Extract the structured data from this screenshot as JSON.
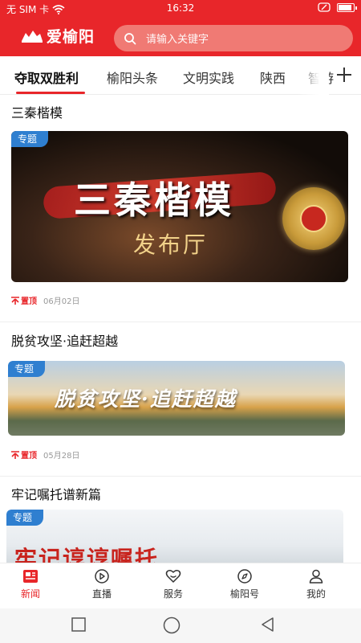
{
  "status_bar": {
    "carrier": "无 SIM 卡",
    "time": "16:32",
    "battery_level": 0.95
  },
  "header": {
    "logo_text": "爱榆阳",
    "search_placeholder": "请输入关键字"
  },
  "tabs": [
    "夺取双胜利",
    "榆阳头条",
    "文明实践",
    "陕西",
    "智游"
  ],
  "active_tab": "夺取双胜利",
  "feed": [
    {
      "title": "三秦楷模",
      "tag": "专题",
      "banner_title": "三秦楷模",
      "banner_subtitle": "发布厅",
      "pin": "置顶",
      "date": "06月02日"
    },
    {
      "title": "脱贫攻坚·追赶超越",
      "tag": "专题",
      "banner_title": "脱贫攻坚·追赶超越",
      "pin": "置顶",
      "date": "05月28日"
    },
    {
      "title": "牢记嘱托谱新篇",
      "tag": "专题",
      "banner_title": "牢记谆谆嘱托"
    }
  ],
  "bottom_nav": [
    {
      "label": "新闻",
      "icon": "news-icon",
      "active": true
    },
    {
      "label": "直播",
      "icon": "live-icon"
    },
    {
      "label": "服务",
      "icon": "service-icon"
    },
    {
      "label": "榆阳号",
      "icon": "compass-icon"
    },
    {
      "label": "我的",
      "icon": "user-icon"
    }
  ],
  "colors": {
    "brand_red": "#e8262a",
    "tag_blue": "#2f7fd0"
  }
}
